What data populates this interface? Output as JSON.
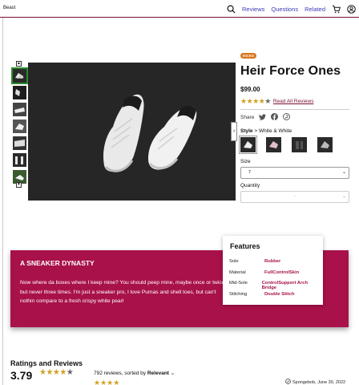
{
  "header": {
    "brand": "Beast",
    "links": [
      "Reviews",
      "Questions",
      "Related"
    ],
    "accent": "#7a1034"
  },
  "gallery": {
    "thumb_count": 7,
    "active_index": 0
  },
  "product": {
    "badge": "KICKS",
    "title": "Heir Force Ones",
    "price": "$99.00",
    "rating": 4,
    "rating_max": 5,
    "reviews_link": "Read All Reviews",
    "share_label": "Share",
    "style_label": "Style",
    "style_separator": ">",
    "style_value": "White & White",
    "size_label": "Size",
    "size_value": "7",
    "quantity_label": "Quantity",
    "quantity_value": "-"
  },
  "dynasty": {
    "title": "A SNEAKER DYNASTY",
    "body": "Now where da boxes where I keep mine? You should peep mine, maybe once or twice but never three times. I'm just a sneaker pro, I love Pumas and shell toes, but can't nothin compare to a fresh crispy white pearl",
    "bg": "#a8114a"
  },
  "features": {
    "title": "Features",
    "rows": [
      {
        "key": "Sole",
        "value": "Rubber"
      },
      {
        "key": "Material",
        "value": "FullControlSkin"
      },
      {
        "key": "Mid-Sole",
        "value": "ControlSupport Arch Bridge"
      },
      {
        "key": "Stitching",
        "value": "Double Stitch"
      }
    ]
  },
  "ratings": {
    "title": "Ratings and Reviews",
    "score": "3.79",
    "reviews_count": "792 reviews, sorted by",
    "sort_value": "Relevant",
    "review_user": "Spongebob, June 30, 2022"
  },
  "icons": [
    "search-icon",
    "cart-icon",
    "user-icon",
    "twitter-icon",
    "facebook-icon",
    "pinterest-icon",
    "check-circle-icon",
    "chevron-down-icon"
  ]
}
